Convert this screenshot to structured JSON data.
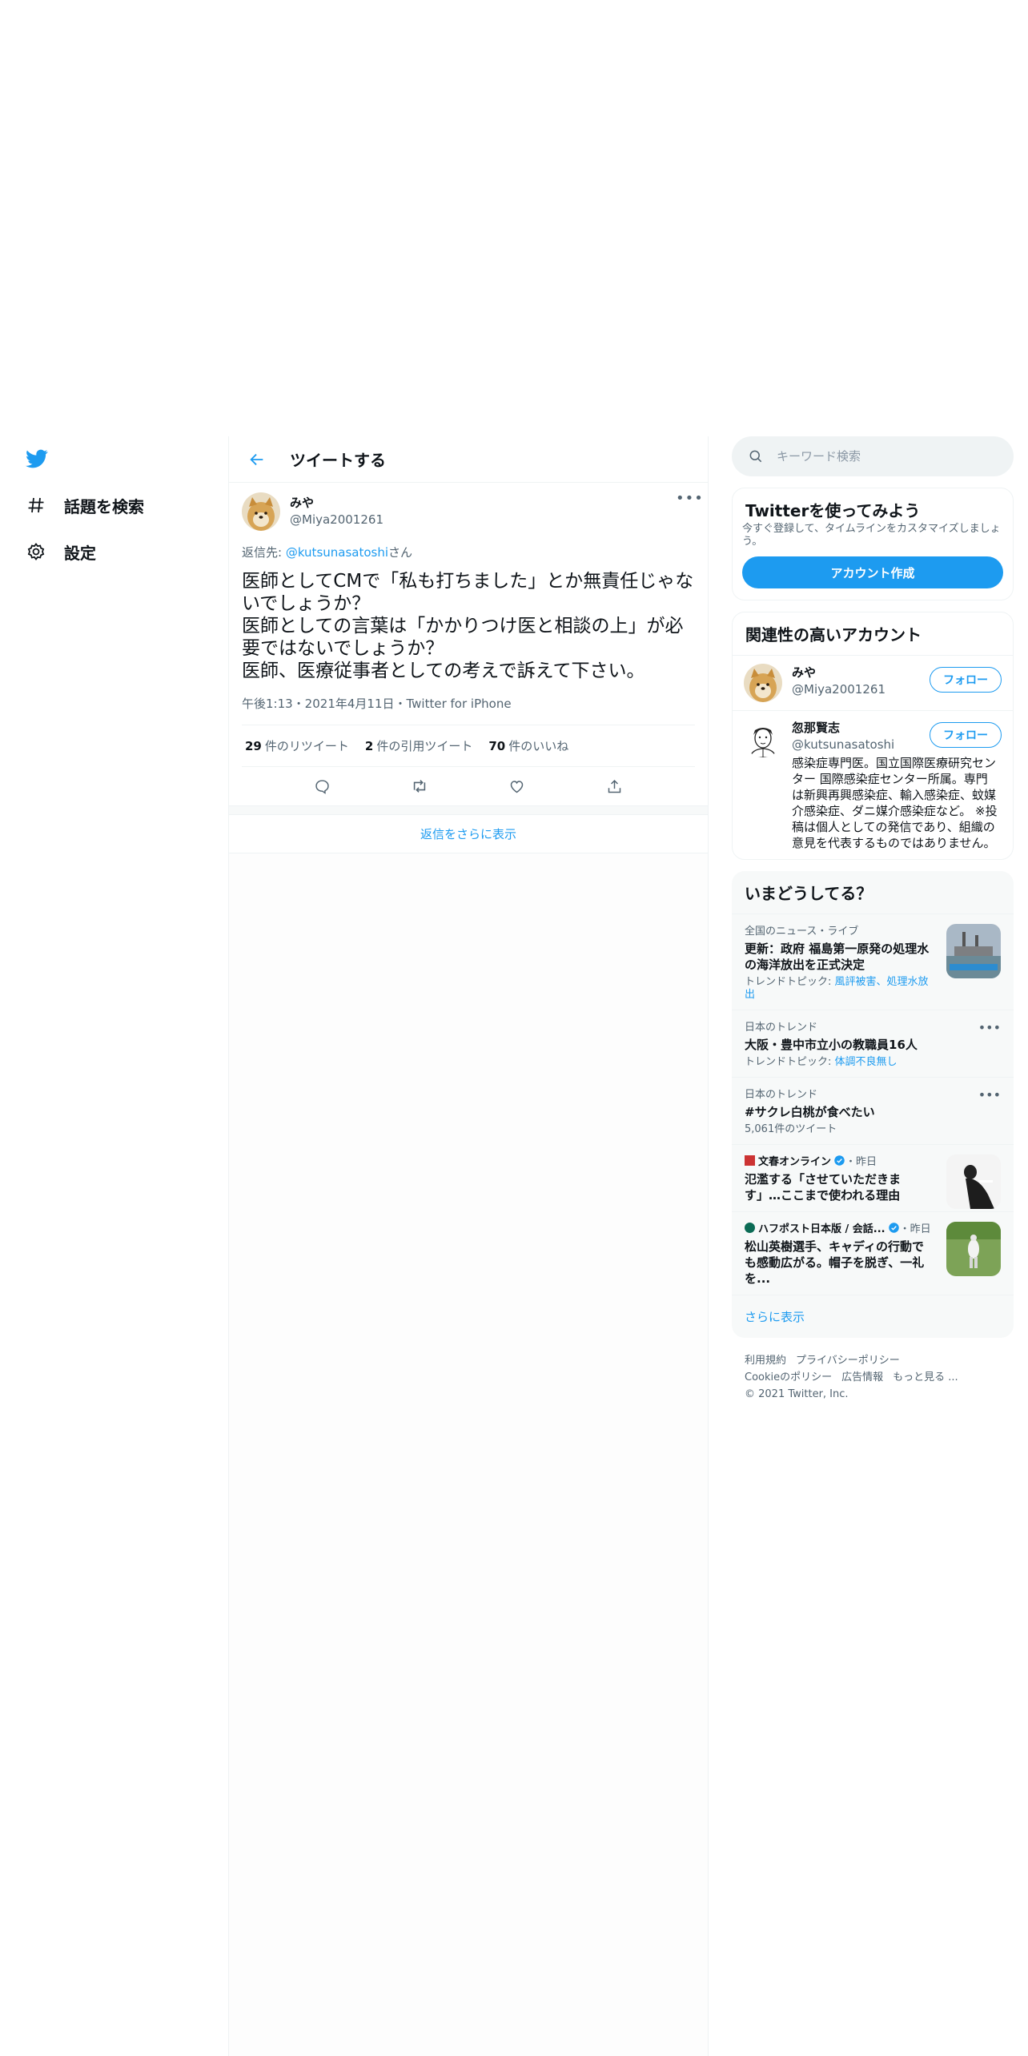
{
  "nav": {
    "items": [
      {
        "label": "話題を検索",
        "icon": "hashtag-icon"
      },
      {
        "label": "設定",
        "icon": "gear-icon"
      }
    ]
  },
  "main": {
    "header_title": "ツイートする",
    "tweet": {
      "author_name": "みや",
      "author_handle": "@Miya2001261",
      "reply_prefix": "返信先: ",
      "reply_handle": "@kutsunasatoshi",
      "reply_suffix": "さん",
      "text": "医師としてCMで「私も打ちました」とか無責任じゃないでしょうか？\n医師としての言葉は「かかりつけ医と相談の上」が必要ではないでしょうか？\n医師、医療従事者としての考えで訴えて下さい。",
      "meta": "午後1:13・2021年4月11日・Twitter for iPhone",
      "stats": [
        {
          "count": "29",
          "label": "件のリツイート"
        },
        {
          "count": "2",
          "label": "件の引用ツイート"
        },
        {
          "count": "70",
          "label": "件のいいね"
        }
      ]
    },
    "show_more_replies": "返信をさらに表示"
  },
  "sidebar": {
    "search_placeholder": "キーワード検索",
    "signup": {
      "title": "Twitterを使ってみよう",
      "text": "今すぐ登録して、タイムラインをカスタマイズしましょう。",
      "button": "アカウント作成"
    },
    "relevant": {
      "title": "関連性の高いアカウント",
      "follow_label": "フォロー",
      "users": [
        {
          "name": "みや",
          "handle": "@Miya2001261",
          "bio": ""
        },
        {
          "name": "忽那賢志",
          "handle": "@kutsunasatoshi",
          "bio": "感染症専門医。国立国際医療研究センター 国際感染症センター所属。専門は新興再興感染症、輸入感染症、蚊媒介感染症、ダニ媒介感染症など。 ※投稿は個人としての発信であり、組織の意見を代表するものではありません。"
        }
      ]
    },
    "trends": {
      "title": "いまどうしてる？",
      "items": [
        {
          "context": "全国のニュース・ライブ",
          "headline": "更新：政府 福島第一原発の処理水の海洋放出を正式決定",
          "sub_prefix": "トレンドトピック: ",
          "sub_link": "風評被害、処理水放出"
        },
        {
          "context": "日本のトレンド",
          "headline": "大阪・豊中市立小の教職員16人",
          "sub_prefix": "トレンドトピック: ",
          "sub_link": "体調不良無し"
        },
        {
          "context": "日本のトレンド",
          "headline": "#サクレ白桃が食べたい",
          "sub_prefix": "5,061件のツイート",
          "sub_link": ""
        },
        {
          "context": "文春オンライン",
          "time": "・昨日",
          "headline": "氾濫する「させていただきます」…ここまで使われる理由"
        },
        {
          "context": "ハフポスト日本版 / 会話...",
          "time": "・昨日",
          "headline": "松山英樹選手、キャディの行動でも感動広がる。帽子を脱ぎ、一礼を..."
        }
      ],
      "show_more": "さらに表示"
    },
    "footer": {
      "links": [
        "利用規約",
        "プライバシーポリシー",
        "Cookieのポリシー",
        "広告情報",
        "もっと見る ..."
      ],
      "copyright": "© 2021 Twitter, Inc."
    }
  },
  "colors": {
    "accent": "#1d9bf0",
    "text": "#0f1419",
    "muted": "#536471"
  }
}
